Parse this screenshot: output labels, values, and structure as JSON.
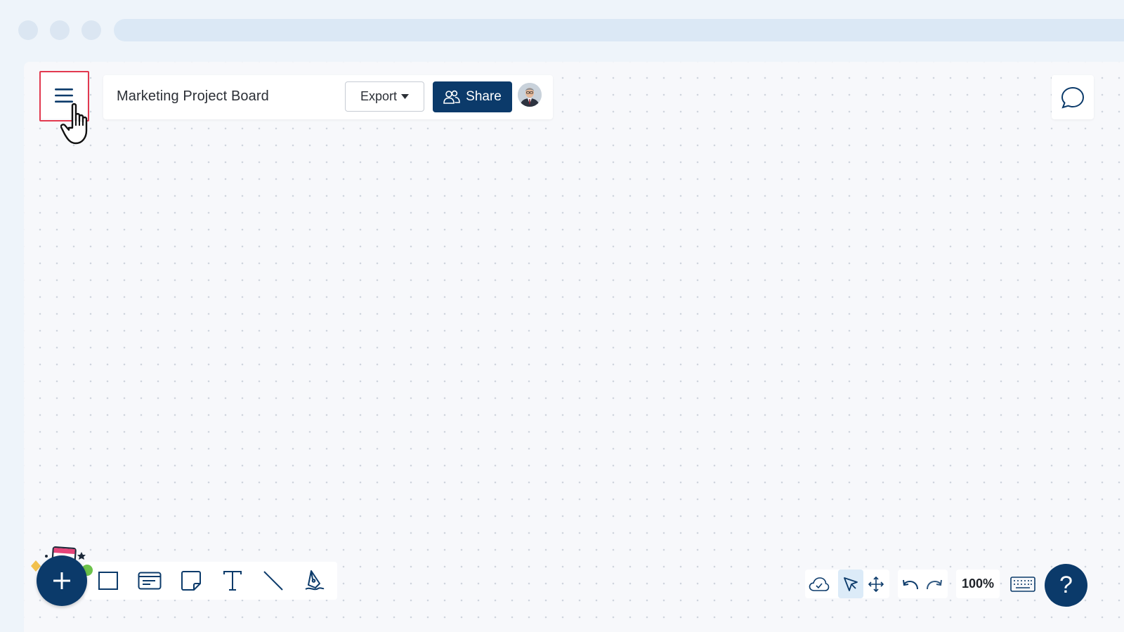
{
  "board": {
    "title": "Marketing Project Board"
  },
  "header": {
    "export_label": "Export",
    "share_label": "Share"
  },
  "zoom": {
    "level": "100%"
  },
  "help": {
    "glyph": "?"
  },
  "colors": {
    "primary": "#0b3a6a",
    "highlight": "#e2394f",
    "canvas_bg": "#f7f8fb"
  },
  "icons": {
    "menu": "hamburger-icon",
    "cursor": "pointer-hand-icon",
    "chat": "comment-icon",
    "share": "users-icon",
    "tools": [
      "rectangle-icon",
      "card-icon",
      "sticky-note-icon",
      "text-icon",
      "line-icon",
      "pen-icon"
    ],
    "bottom_right": [
      "cloud-sync-icon",
      "select-arrow-icon",
      "pan-icon",
      "undo-icon",
      "redo-icon",
      "keyboard-icon"
    ]
  }
}
